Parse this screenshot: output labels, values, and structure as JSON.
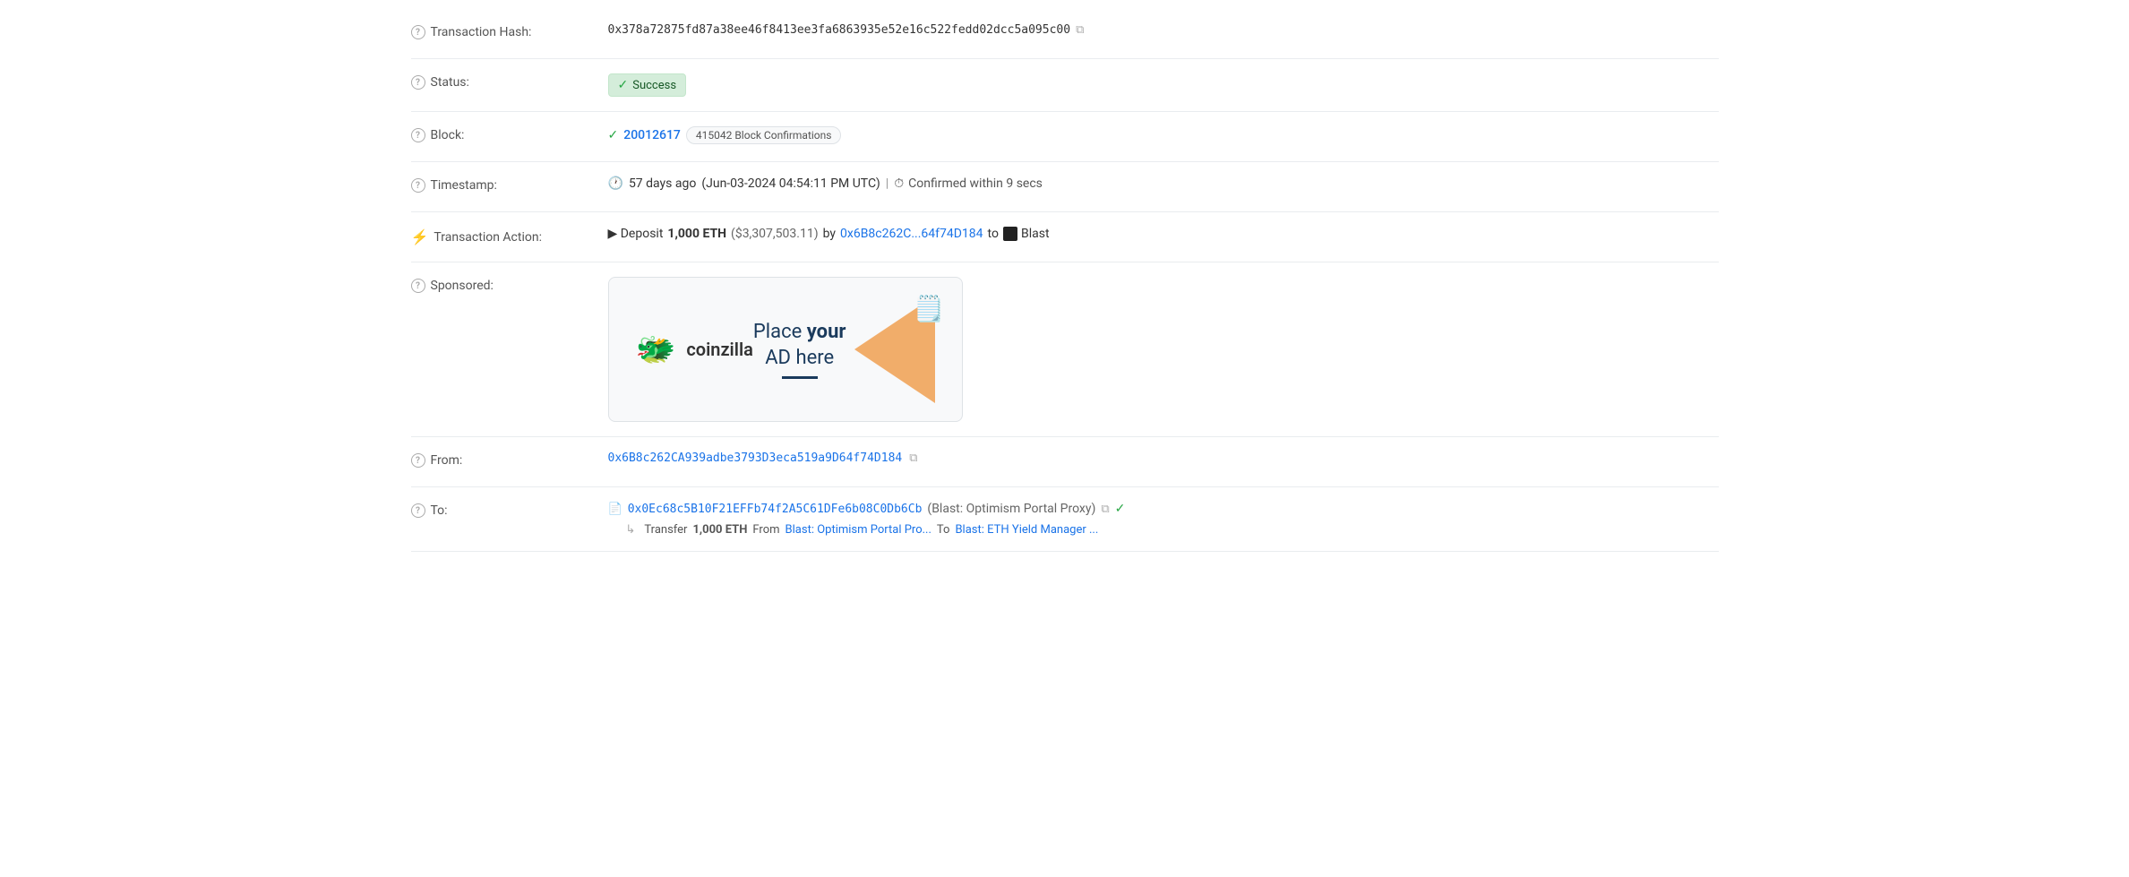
{
  "rows": {
    "transaction_hash": {
      "label": "Transaction Hash:",
      "value": "0x378a72875fd87a38ee46f8413ee3fa6863935e52e16c522fedd02dcc5a095c00"
    },
    "status": {
      "label": "Status:",
      "badge": "Success"
    },
    "block": {
      "label": "Block:",
      "number": "20012617",
      "confirmations": "415042 Block Confirmations"
    },
    "timestamp": {
      "label": "Timestamp:",
      "ago": "57 days ago",
      "date": "(Jun-03-2024 04:54:11 PM UTC)",
      "separator": "|",
      "confirmed": "Confirmed within 9 secs"
    },
    "transaction_action": {
      "label": "Transaction Action:",
      "prefix": "▶ Deposit",
      "amount": "1,000 ETH",
      "usd": "($3,307,503.11)",
      "by": "by",
      "from_address": "0x6B8c262C...64f74D184",
      "to_text": "to",
      "blast_label": "Blast"
    },
    "sponsored": {
      "label": "Sponsored:",
      "coinzilla_emoji": "🐲",
      "coinzilla_text": "coinzilla",
      "ad_place": "Place",
      "ad_your": "your",
      "ad_text": "AD here"
    },
    "from": {
      "label": "From:",
      "address": "0x6B8c262CA939adbe3793D3eca519a9D64f74D184"
    },
    "to": {
      "label": "To:",
      "contract_address": "0x0Ec68c5B10F21EFFb74f2A5C61DFe6b08C0Db6Cb",
      "contract_name": "(Blast: Optimism Portal Proxy)",
      "transfer_label": "Transfer",
      "transfer_amount": "1,000 ETH",
      "transfer_from_label": "From",
      "transfer_from": "Blast: Optimism Portal Pro...",
      "transfer_to_label": "To",
      "transfer_to": "Blast: ETH Yield Manager ..."
    }
  },
  "icons": {
    "help": "?",
    "check_circle": "✓",
    "clock": "🕐",
    "alarm": "⏱",
    "lightning": "⚡",
    "copy": "⧉",
    "contract": "📄",
    "verified": "✓",
    "arrow_right": "▸"
  },
  "colors": {
    "blue_link": "#1a73e8",
    "success_green": "#28a745",
    "badge_bg": "#d4edda",
    "badge_border": "#c3e6cb",
    "badge_text": "#155724"
  }
}
